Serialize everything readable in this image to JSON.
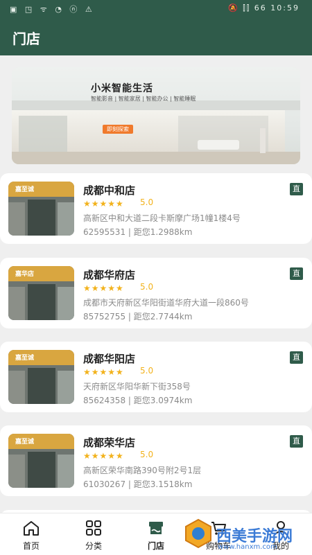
{
  "status_bar": {
    "left_icons": "▣ ◳ ᯤ ◔ ⓝ ⚠",
    "right": "🔕 ⫿⫿ 66",
    "time": "10:59"
  },
  "app_bar": {
    "title": "门店"
  },
  "banner": {
    "headline": "小米智能生活",
    "subtitle": "智能影音 | 智能家居 | 智能办公 | 智能睡眠",
    "button": "即刻探索"
  },
  "stores": [
    {
      "name": "成都中和店",
      "stars": "★★★★★",
      "rating": "5.0",
      "address": "高新区中和大道二段卡斯摩广场1幢1楼4号",
      "phone": "62595531",
      "distance": "距您1.2988km",
      "badge": "直",
      "sign": "嘉至诚"
    },
    {
      "name": "成都华府店",
      "stars": "★★★★★",
      "rating": "5.0",
      "address": "成都市天府新区华阳街道华府大道一段860号",
      "phone": "85752755",
      "distance": "距您2.7744km",
      "badge": "直",
      "sign": "嘉华店"
    },
    {
      "name": "成都华阳店",
      "stars": "★★★★★",
      "rating": "5.0",
      "address": "天府新区华阳华新下街358号",
      "phone": "85624358",
      "distance": "距您3.0974km",
      "badge": "直",
      "sign": "嘉至诚"
    },
    {
      "name": "成都荣华店",
      "stars": "★★★★★",
      "rating": "5.0",
      "address": "高新区荣华南路390号附2号1层",
      "phone": "61030267",
      "distance": "距您3.1518km",
      "badge": "直",
      "sign": "嘉至诚"
    }
  ],
  "tabs": [
    {
      "label": "首页",
      "icon": "home-icon"
    },
    {
      "label": "分类",
      "icon": "grid-icon"
    },
    {
      "label": "门店",
      "icon": "store-icon"
    },
    {
      "label": "购物车",
      "icon": "cart-icon"
    },
    {
      "label": "我的",
      "icon": "user-icon"
    }
  ],
  "watermark": {
    "text": "西美手游网",
    "url": "www.hanxm.com"
  },
  "colors": {
    "primary": "#2f5b4a",
    "star": "#f2b21c",
    "banner_button": "#f07a2c"
  }
}
